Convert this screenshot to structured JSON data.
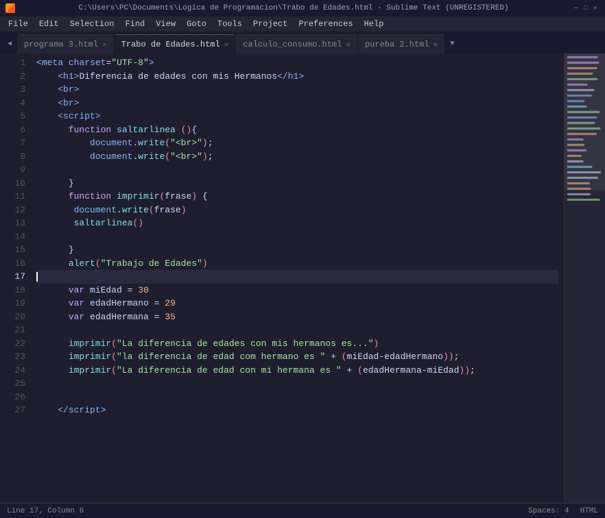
{
  "titleBar": {
    "path": "C:\\Users\\PC\\Documents\\Logica de Programacion\\Trabo de Edades.html - Sublime Text (UNREGISTERED)"
  },
  "menuBar": {
    "items": [
      "File",
      "Edit",
      "Selection",
      "Find",
      "View",
      "Goto",
      "Tools",
      "Project",
      "Preferences",
      "Help"
    ]
  },
  "tabs": [
    {
      "label": "programa 3.html",
      "active": false
    },
    {
      "label": "Trabo de Edades.html",
      "active": true
    },
    {
      "label": "calculo_consumo.html",
      "active": false
    },
    {
      "label": "pureba 2.html",
      "active": false
    }
  ],
  "lineNumbers": [
    1,
    2,
    3,
    4,
    5,
    6,
    7,
    8,
    9,
    10,
    11,
    12,
    13,
    14,
    15,
    16,
    17,
    18,
    19,
    20,
    21,
    22,
    23,
    24,
    25,
    26,
    27
  ],
  "currentLine": 17,
  "statusBar": {
    "line": "Line 17, Column 6",
    "spaces": "Spaces: 4",
    "encoding": "",
    "syntax": "HTML"
  }
}
